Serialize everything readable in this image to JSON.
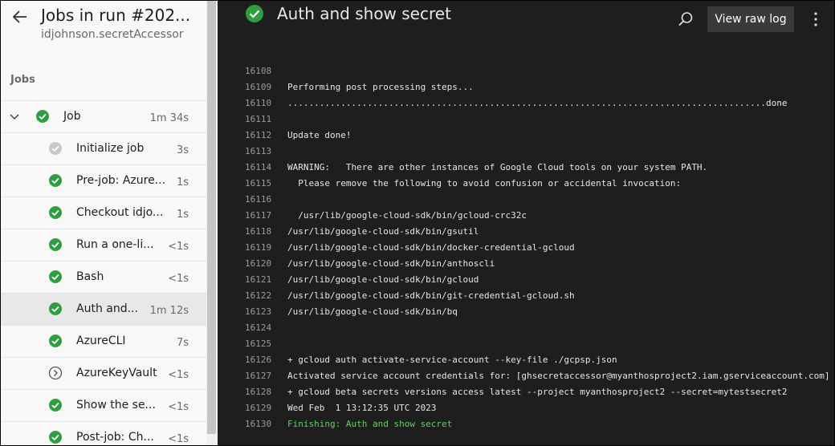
{
  "sidebar": {
    "title": "Jobs in run #202...",
    "subtitle": "idjohnson.secretAccessor",
    "section_label": "Jobs",
    "job": {
      "label": "Job",
      "duration": "1m 34s",
      "status": "success"
    },
    "steps": [
      {
        "label": "Initialize job",
        "duration": "3s",
        "status": "done-gray"
      },
      {
        "label": "Pre-job: Azure...",
        "duration": "1s",
        "status": "success"
      },
      {
        "label": "Checkout idjo...",
        "duration": "1s",
        "status": "success"
      },
      {
        "label": "Run a one-li...",
        "duration": "<1s",
        "status": "success"
      },
      {
        "label": "Bash",
        "duration": "<1s",
        "status": "success"
      },
      {
        "label": "Auth and...",
        "duration": "1m 12s",
        "status": "success",
        "active": true
      },
      {
        "label": "AzureCLI",
        "duration": "7s",
        "status": "success"
      },
      {
        "label": "AzureKeyVault",
        "duration": "<1s",
        "status": "skipped"
      },
      {
        "label": "Show the se...",
        "duration": "<1s",
        "status": "success"
      },
      {
        "label": "Post-job: Ch...",
        "duration": "<1s",
        "status": "success"
      }
    ]
  },
  "main": {
    "title": "Auth and show secret",
    "view_raw_label": "View raw log",
    "log_lines": [
      {
        "num": "16108",
        "text": ""
      },
      {
        "num": "16109",
        "text": "Performing post processing steps..."
      },
      {
        "num": "16110",
        "text": "..........................................................................................done"
      },
      {
        "num": "16111",
        "text": ""
      },
      {
        "num": "16112",
        "text": "Update done!"
      },
      {
        "num": "16113",
        "text": ""
      },
      {
        "num": "16114",
        "text": "WARNING:   There are other instances of Google Cloud tools on your system PATH."
      },
      {
        "num": "16115",
        "text": "  Please remove the following to avoid confusion or accidental invocation:"
      },
      {
        "num": "16116",
        "text": ""
      },
      {
        "num": "16117",
        "text": "  /usr/lib/google-cloud-sdk/bin/gcloud-crc32c"
      },
      {
        "num": "16118",
        "text": "/usr/lib/google-cloud-sdk/bin/gsutil"
      },
      {
        "num": "16119",
        "text": "/usr/lib/google-cloud-sdk/bin/docker-credential-gcloud"
      },
      {
        "num": "16120",
        "text": "/usr/lib/google-cloud-sdk/bin/anthoscli"
      },
      {
        "num": "16121",
        "text": "/usr/lib/google-cloud-sdk/bin/gcloud"
      },
      {
        "num": "16122",
        "text": "/usr/lib/google-cloud-sdk/bin/git-credential-gcloud.sh"
      },
      {
        "num": "16123",
        "text": "/usr/lib/google-cloud-sdk/bin/bq"
      },
      {
        "num": "16124",
        "text": ""
      },
      {
        "num": "16125",
        "text": ""
      },
      {
        "num": "16126",
        "text": "+ gcloud auth activate-service-account --key-file ./gcpsp.json"
      },
      {
        "num": "16127",
        "text": "Activated service account credentials for: [ghsecretaccessor@myanthosproject2.iam.gserviceaccount.com]"
      },
      {
        "num": "16128",
        "text": "+ gcloud beta secrets versions access latest --project myanthosproject2 --secret=mytestsecret2"
      },
      {
        "num": "16129",
        "text": "Wed Feb  1 13:12:35 UTC 2023"
      },
      {
        "num": "16130",
        "text": "Finishing: Auth and show secret",
        "highlight": "green"
      }
    ]
  },
  "colors": {
    "success": "#2e9e3f",
    "done_gray": "#c8c8c8",
    "skipped": "#555555",
    "finishing_text": "#5fd35f",
    "log_bg": "#1e1e1e",
    "sidebar_bg": "#f8f8f8"
  },
  "icons": {
    "back": "arrow-left-icon",
    "success": "check-circle-icon",
    "done_gray": "check-circle-gray-icon",
    "skipped": "chevron-circle-icon",
    "expand": "chevron-down-icon",
    "search": "search-icon",
    "more": "more-vertical-icon"
  }
}
